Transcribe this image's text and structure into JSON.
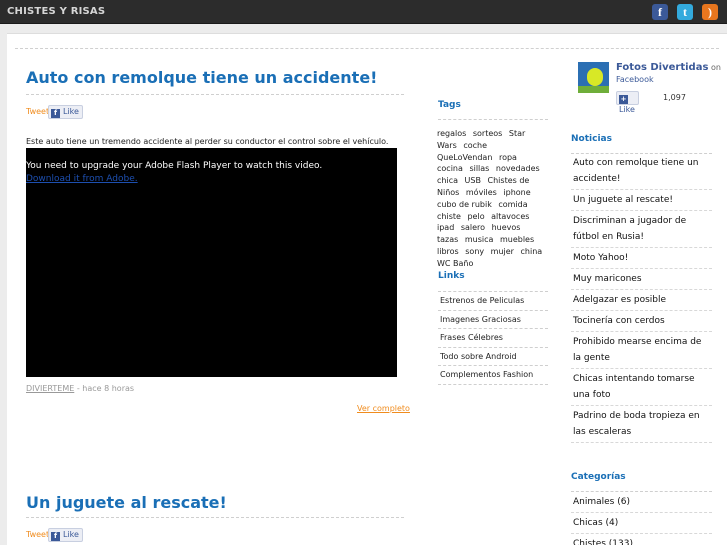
{
  "header": {
    "site_title": "CHISTES Y RISAS",
    "icons": [
      "facebook-icon",
      "twitter-icon",
      "rss-icon"
    ]
  },
  "colors": {
    "accent_blue": "#1a6fb6",
    "facebook_blue": "#3b5998",
    "orange": "#f08c1e",
    "topbar": "#2c2c2c"
  },
  "posts": [
    {
      "title": "Auto con remolque tiene un accidente!",
      "tweet_label": "Tweet",
      "like_label": "Like",
      "excerpt": "Este auto tiene un tremendo accidente al perder su conductor el control sobre el vehículo.",
      "flash_message": "You need to upgrade your Adobe Flash Player to watch this video.",
      "flash_link": "Download it from Adobe.",
      "author": "DIVIERTEME",
      "time": " - hace 8 horas",
      "read_more": "Ver completo"
    },
    {
      "title": "Un juguete al rescate!",
      "tweet_label": "Tweet",
      "like_label": "Like"
    }
  ],
  "tags_widget": {
    "heading": "Tags",
    "tags": [
      "regalos",
      "sorteos",
      "Star Wars",
      "coche",
      "QueLoVendan",
      "ropa",
      "cocina",
      "sillas",
      "novedades",
      "chica",
      "USB",
      "Chistes de Niños",
      "móviles",
      "iphone",
      "cubo de rubik",
      "comida",
      "chiste",
      "pelo",
      "altavoces",
      "ipad",
      "salero",
      "huevos",
      "tazas",
      "musica",
      "muebles",
      "libros",
      "sony",
      "mujer",
      "china",
      "WC Baño"
    ]
  },
  "links_widget": {
    "heading": "Links",
    "items": [
      "Estrenos de Peliculas",
      "Imagenes Graciosas",
      "Frases Célebres",
      "Todo sobre Android",
      "Complementos Fashion"
    ]
  },
  "facebook_widget": {
    "name": "Fotos Divertidas",
    "on": " on",
    "platform": "Facebook",
    "like_label": "Like",
    "like_count": "1,097"
  },
  "noticias": {
    "heading": "Noticias",
    "items": [
      "Auto con remolque tiene un accidente!",
      "Un juguete al rescate!",
      "Discriminan a jugador de fútbol en Rusia!",
      "Moto Yahoo!",
      "Muy maricones",
      "Adelgazar es posible",
      "Tocinería con cerdos",
      "Prohibido mearse encima de la gente",
      "Chicas intentando tomarse una foto",
      "Padrino de boda tropieza en las escaleras"
    ]
  },
  "categorias": {
    "heading": "Categorías",
    "items": [
      "Animales (6)",
      "Chicas (4)",
      "Chistes (133)"
    ]
  }
}
